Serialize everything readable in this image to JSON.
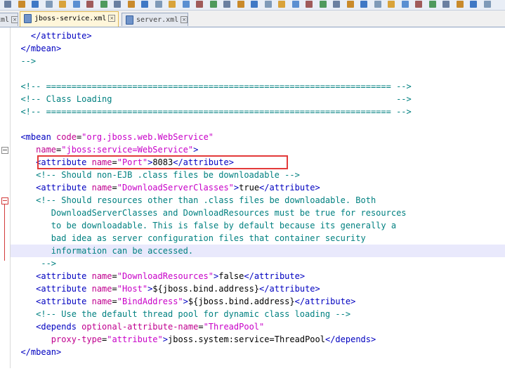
{
  "tabs": [
    {
      "label": "xml",
      "active": false
    },
    {
      "label": "jboss-service.xml",
      "active": true
    },
    {
      "label": "server.xml",
      "active": false
    }
  ],
  "colors": {
    "tag": "#0000c0",
    "attr_name": "#c0008f",
    "attr_value": "#c800c8",
    "comment": "#008080",
    "highlight_border": "#e33a3a"
  },
  "editor": {
    "lines": [
      [
        {
          "t": "tg",
          "v": "    </attribute>"
        }
      ],
      [
        {
          "t": "tg",
          "v": "  </mbean>"
        }
      ],
      [
        {
          "t": "cm",
          "v": "  -->"
        }
      ],
      [],
      [
        {
          "t": "cm",
          "v": "  <!-- ==================================================================== -->"
        }
      ],
      [
        {
          "t": "cm",
          "v": "  <!-- Class Loading                                                        -->"
        }
      ],
      [
        {
          "t": "cm",
          "v": "  <!-- ==================================================================== -->"
        }
      ],
      [],
      [
        {
          "t": "tg",
          "v": "  <mbean "
        },
        {
          "t": "an",
          "v": "code"
        },
        {
          "t": "tx",
          "v": "="
        },
        {
          "t": "av",
          "v": "\"org.jboss.web.WebService\""
        }
      ],
      [
        {
          "t": "tx",
          "v": "     "
        },
        {
          "t": "an",
          "v": "name"
        },
        {
          "t": "tx",
          "v": "="
        },
        {
          "t": "av",
          "v": "\"jboss:service=WebService\""
        },
        {
          "t": "tg",
          "v": ">"
        }
      ],
      [
        {
          "t": "tg",
          "v": "     <attribute "
        },
        {
          "t": "an",
          "v": "name"
        },
        {
          "t": "tx",
          "v": "="
        },
        {
          "t": "av",
          "v": "\"Port\""
        },
        {
          "t": "tg",
          "v": ">"
        },
        {
          "t": "tx",
          "v": "8083"
        },
        {
          "t": "tg",
          "v": "</attribute>"
        }
      ],
      [
        {
          "t": "cm",
          "v": "     <!-- Should non-EJB .class files be downloadable -->"
        }
      ],
      [
        {
          "t": "tg",
          "v": "     <attribute "
        },
        {
          "t": "an",
          "v": "name"
        },
        {
          "t": "tx",
          "v": "="
        },
        {
          "t": "av",
          "v": "\"DownloadServerClasses\""
        },
        {
          "t": "tg",
          "v": ">"
        },
        {
          "t": "tx",
          "v": "true"
        },
        {
          "t": "tg",
          "v": "</attribute>"
        }
      ],
      [
        {
          "t": "cm",
          "v": "     <!-- Should resources other than .class files be downloadable. Both"
        }
      ],
      [
        {
          "t": "cm",
          "v": "        DownloadServerClasses and DownloadResources must be true for resources"
        }
      ],
      [
        {
          "t": "cm",
          "v": "        to be downloadable. This is false by default because its generally a"
        }
      ],
      [
        {
          "t": "cm",
          "v": "        bad idea as server configuration files that container security"
        }
      ],
      [
        {
          "t": "cm",
          "v": "        information can be accessed."
        }
      ],
      [
        {
          "t": "cm",
          "v": "      -->"
        }
      ],
      [
        {
          "t": "tg",
          "v": "     <attribute "
        },
        {
          "t": "an",
          "v": "name"
        },
        {
          "t": "tx",
          "v": "="
        },
        {
          "t": "av",
          "v": "\"DownloadResources\""
        },
        {
          "t": "tg",
          "v": ">"
        },
        {
          "t": "tx",
          "v": "false"
        },
        {
          "t": "tg",
          "v": "</attribute>"
        }
      ],
      [
        {
          "t": "tg",
          "v": "     <attribute "
        },
        {
          "t": "an",
          "v": "name"
        },
        {
          "t": "tx",
          "v": "="
        },
        {
          "t": "av",
          "v": "\"Host\""
        },
        {
          "t": "tg",
          "v": ">"
        },
        {
          "t": "tx",
          "v": "${jboss.bind.address}"
        },
        {
          "t": "tg",
          "v": "</attribute>"
        }
      ],
      [
        {
          "t": "tg",
          "v": "     <attribute "
        },
        {
          "t": "an",
          "v": "name"
        },
        {
          "t": "tx",
          "v": "="
        },
        {
          "t": "av",
          "v": "\"BindAddress\""
        },
        {
          "t": "tg",
          "v": ">"
        },
        {
          "t": "tx",
          "v": "${jboss.bind.address}"
        },
        {
          "t": "tg",
          "v": "</attribute>"
        }
      ],
      [
        {
          "t": "cm",
          "v": "     <!-- Use the default thread pool for dynamic class loading -->"
        }
      ],
      [
        {
          "t": "tg",
          "v": "     <depends "
        },
        {
          "t": "an",
          "v": "optional-attribute-name"
        },
        {
          "t": "tx",
          "v": "="
        },
        {
          "t": "av",
          "v": "\"ThreadPool\""
        }
      ],
      [
        {
          "t": "tx",
          "v": "        "
        },
        {
          "t": "an",
          "v": "proxy-type"
        },
        {
          "t": "tx",
          "v": "="
        },
        {
          "t": "av",
          "v": "\"attribute\""
        },
        {
          "t": "tg",
          "v": ">"
        },
        {
          "t": "tx",
          "v": "jboss.system:service=ThreadPool"
        },
        {
          "t": "tg",
          "v": "</depends>"
        }
      ],
      [
        {
          "t": "tg",
          "v": "  </mbean>"
        }
      ],
      []
    ]
  }
}
